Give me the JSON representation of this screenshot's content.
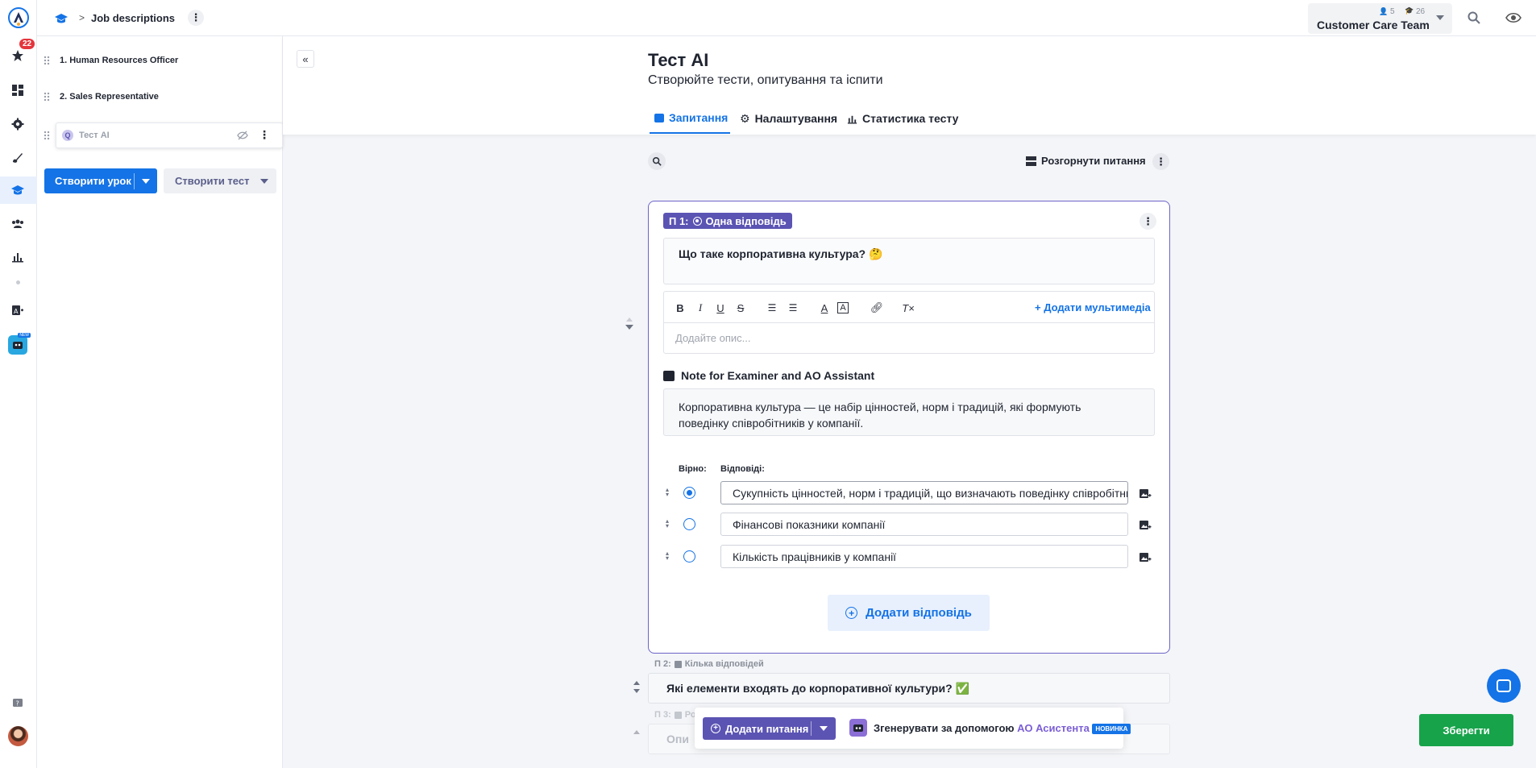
{
  "rail": {
    "notifications_count": "22"
  },
  "topbar": {
    "breadcrumb_separator": ">",
    "breadcrumb_title": "Job descriptions",
    "team_count_users": "5",
    "team_count_learners": "26",
    "team_name": "Customer Care Team"
  },
  "course": {
    "lessons": [
      {
        "label": "1. Human Resources Officer"
      },
      {
        "label": "2. Sales Representative"
      },
      {
        "label": "Тест AI"
      }
    ],
    "create_lesson_label": "Створити урок",
    "create_test_label": "Створити тест"
  },
  "test": {
    "title": "Тест AI",
    "subtitle": "Створюйте тести, опитування та іспити",
    "tabs": [
      {
        "label": "Запитання"
      },
      {
        "label": "Налаштування"
      },
      {
        "label": "Статистика тесту"
      }
    ],
    "expand_label": "Розгорнути питання"
  },
  "question1": {
    "tag": "П 1:",
    "type_label": "Одна відповідь",
    "text": "Що таке корпоративна культура? 🤔",
    "add_media_label": "+ Додати мультимедіа",
    "description_placeholder": "Додайте опис...",
    "note_title": "Note for Examiner and AO Assistant",
    "note_text": "Корпоративна культура — це набір цінностей, норм і традицій, які формують поведінку співробітників у компанії.",
    "correct_header": "Вірно:",
    "answers_header": "Відповіді:",
    "answers": [
      {
        "text": "Сукупність цінностей, норм і традицій, що визначають поведінку співробітників",
        "correct": true
      },
      {
        "text": "Фінансові показники компанії",
        "correct": false
      },
      {
        "text": "Кількість працівників у компанії",
        "correct": false
      }
    ],
    "add_answer_label": "Додати відповідь"
  },
  "question2": {
    "tag": "П 2:",
    "type_label": "Кілька відповідей",
    "text": "Які елементи входять до корпоративної культури? ✅"
  },
  "question3": {
    "tag": "П 3:",
    "type_label_partial": "Ро",
    "text_partial": "Опи"
  },
  "bottombar": {
    "add_question_label": "Додати питання",
    "generate_prefix": "Згенерувати за допомогою",
    "generate_link": "АО Асистента",
    "new_badge": "НОВИНКА"
  },
  "save_label": "Зберегти",
  "colors": {
    "primary": "#1473e6",
    "question_accent": "#5b54b3",
    "save": "#17a34a"
  }
}
